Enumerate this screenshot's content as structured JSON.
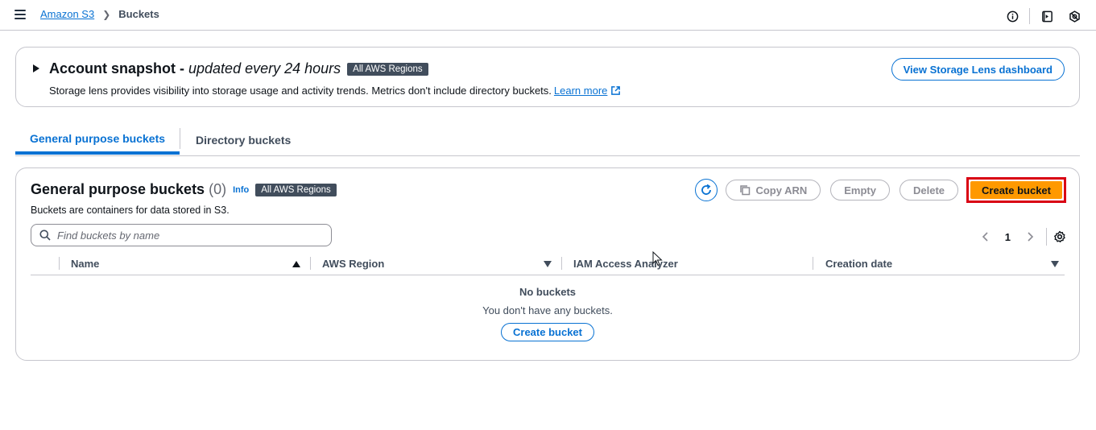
{
  "topbar": {
    "breadcrumb": [
      "Amazon S3",
      "Buckets"
    ],
    "icons": [
      "info-icon",
      "notifications-icon",
      "settings-icon"
    ]
  },
  "snapshot": {
    "title": "Account snapshot -",
    "title_suffix": "updated every 24 hours",
    "badge": "All AWS Regions",
    "description": "Storage lens provides visibility into storage usage and activity trends. Metrics don't include directory buckets.",
    "learn_more": "Learn more",
    "dashboard_button": "View Storage Lens dashboard"
  },
  "tabs": [
    {
      "label": "General purpose buckets",
      "active": true
    },
    {
      "label": "Directory buckets",
      "active": false
    }
  ],
  "panel": {
    "title": "General purpose buckets",
    "count": "(0)",
    "info": "Info",
    "badge": "All AWS Regions",
    "description": "Buckets are containers for data stored in S3.",
    "actions": {
      "copy_arn": "Copy ARN",
      "empty": "Empty",
      "delete": "Delete",
      "create": "Create bucket"
    },
    "search_placeholder": "Find buckets by name",
    "page": "1",
    "columns": [
      "Name",
      "AWS Region",
      "IAM Access Analyzer",
      "Creation date"
    ],
    "empty_title": "No buckets",
    "empty_desc": "You don't have any buckets.",
    "empty_button": "Create bucket"
  },
  "colors": {
    "accent": "#0972d3",
    "primary_button": "#ff9900",
    "highlight_border": "#d90013",
    "badge_bg": "#414d5c"
  }
}
